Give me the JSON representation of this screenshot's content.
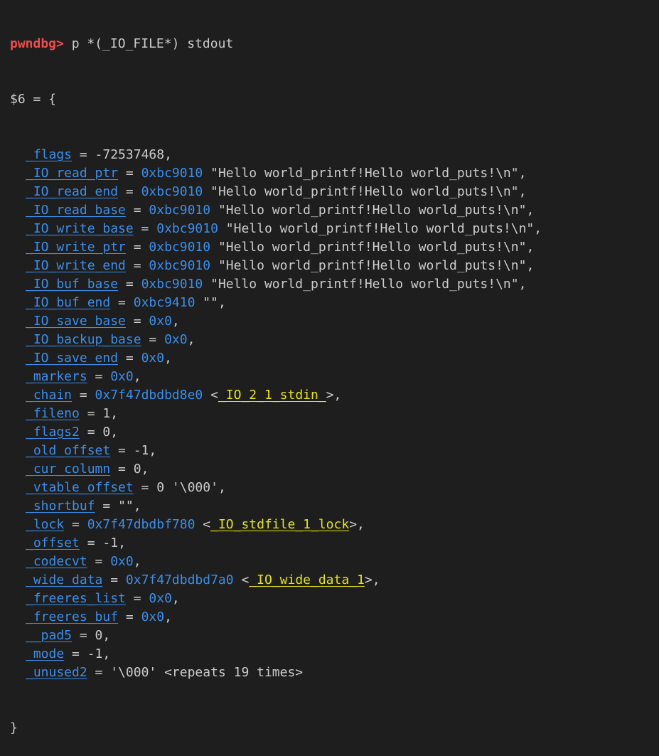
{
  "prompt": "pwndbg>",
  "command": " p *(_IO_FILE*) stdout",
  "result_header": "$6 = {",
  "closing": "}",
  "fields": [
    {
      "name": "_flags",
      "value": "-72537468"
    },
    {
      "name": "_IO_read_ptr",
      "addr": "0xbc9010",
      "value": "\"Hello world_printf!Hello world_puts!\\n\""
    },
    {
      "name": "_IO_read_end",
      "addr": "0xbc9010",
      "value": "\"Hello world_printf!Hello world_puts!\\n\""
    },
    {
      "name": "_IO_read_base",
      "addr": "0xbc9010",
      "value": "\"Hello world_printf!Hello world_puts!\\n\""
    },
    {
      "name": "_IO_write_base",
      "addr": "0xbc9010",
      "value": "\"Hello world_printf!Hello world_puts!\\n\""
    },
    {
      "name": "_IO_write_ptr",
      "addr": "0xbc9010",
      "value": "\"Hello world_printf!Hello world_puts!\\n\""
    },
    {
      "name": "_IO_write_end",
      "addr": "0xbc9010",
      "value": "\"Hello world_printf!Hello world_puts!\\n\""
    },
    {
      "name": "_IO_buf_base",
      "addr": "0xbc9010",
      "value": "\"Hello world_printf!Hello world_puts!\\n\""
    },
    {
      "name": "_IO_buf_end",
      "addr": "0xbc9410",
      "value": "\"\""
    },
    {
      "name": "_IO_save_base",
      "addr": "0x0"
    },
    {
      "name": "_IO_backup_base",
      "addr": "0x0"
    },
    {
      "name": "_IO_save_end",
      "addr": "0x0"
    },
    {
      "name": "_markers",
      "addr": "0x0"
    },
    {
      "name": "_chain",
      "addr": "0x7f47dbdbd8e0",
      "symbol": "_IO_2_1_stdin_"
    },
    {
      "name": "_fileno",
      "value": "1"
    },
    {
      "name": "_flags2",
      "value": "0"
    },
    {
      "name": "_old_offset",
      "value": "-1"
    },
    {
      "name": "_cur_column",
      "value": "0"
    },
    {
      "name": "_vtable_offset",
      "value": "0 '\\000'"
    },
    {
      "name": "_shortbuf",
      "value": "\"\""
    },
    {
      "name": "_lock",
      "addr": "0x7f47dbdbf780",
      "symbol": "_IO_stdfile_1_lock"
    },
    {
      "name": "_offset",
      "value": "-1"
    },
    {
      "name": "_codecvt",
      "addr": "0x0"
    },
    {
      "name": "_wide_data",
      "addr": "0x7f47dbdbd7a0",
      "symbol": "_IO_wide_data_1"
    },
    {
      "name": "_freeres_list",
      "addr": "0x0"
    },
    {
      "name": "_freeres_buf",
      "addr": "0x0"
    },
    {
      "name": "__pad5",
      "value": "0"
    },
    {
      "name": "_mode",
      "value": "-1"
    },
    {
      "name": "_unused2",
      "value": "'\\000' <repeats 19 times>",
      "last": true
    }
  ]
}
